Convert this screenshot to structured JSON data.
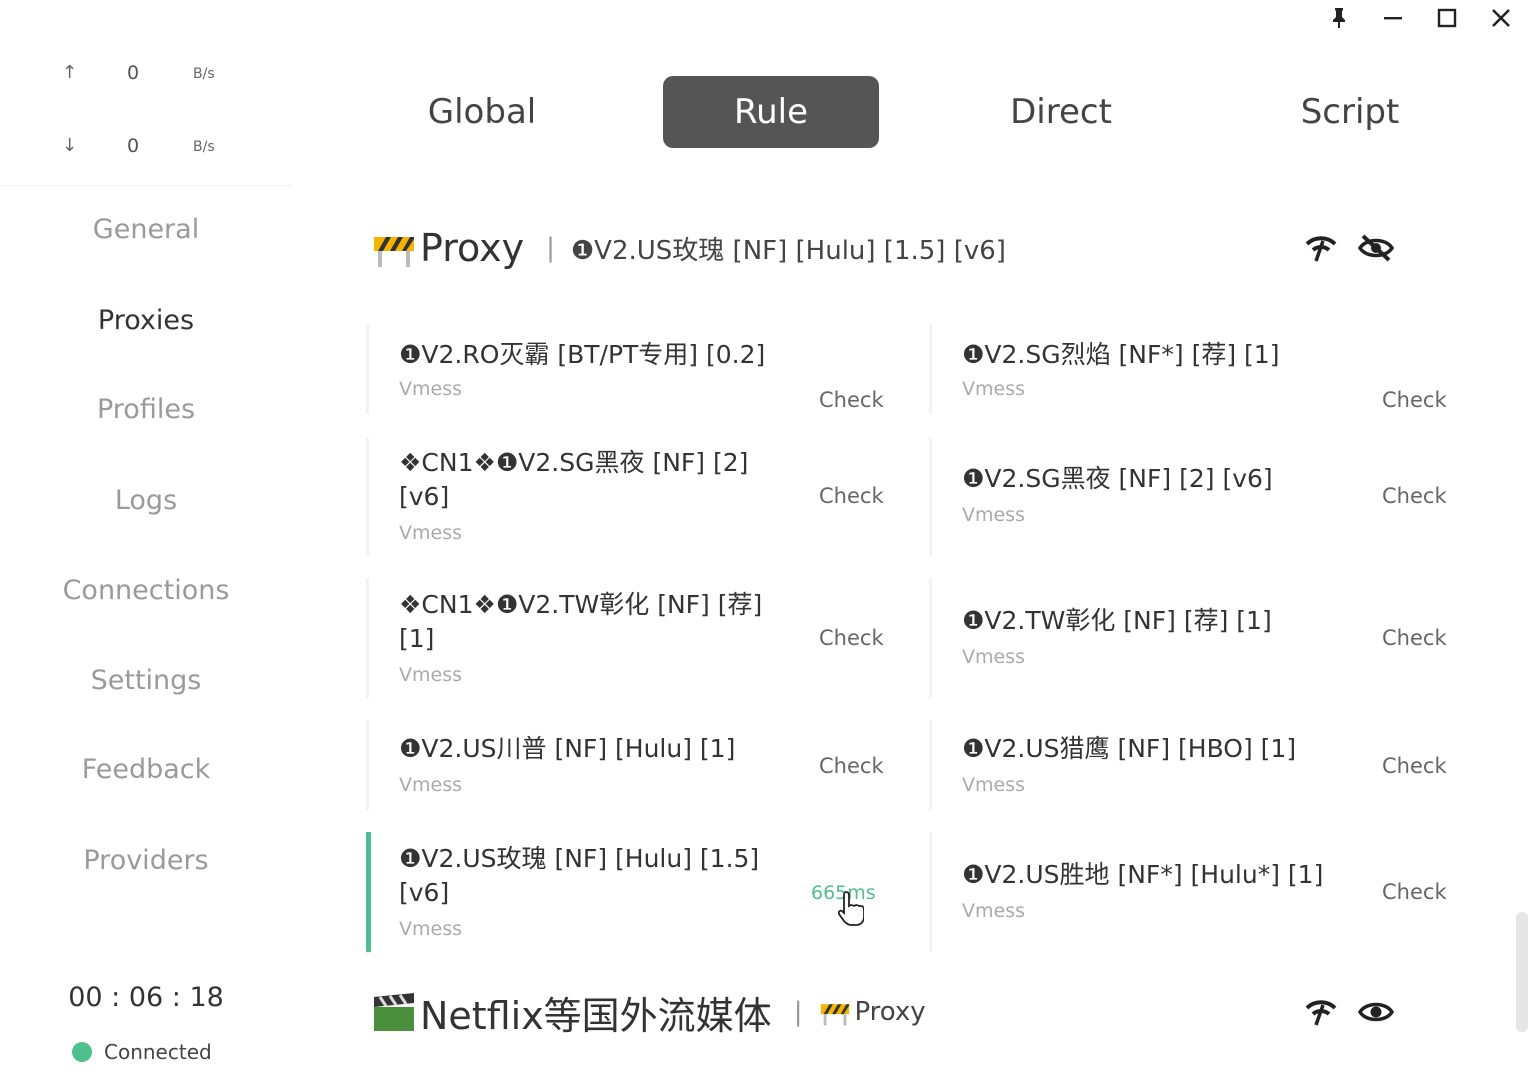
{
  "window": {
    "pin_icon": "pin-icon",
    "minimize_icon": "minimize-icon",
    "maximize_icon": "maximize-icon",
    "close_icon": "close-icon"
  },
  "traffic": {
    "up_arrow": "↑",
    "up_value": "0",
    "up_unit": "B/s",
    "down_arrow": "↓",
    "down_value": "0",
    "down_unit": "B/s"
  },
  "sidebar": {
    "items": [
      {
        "label": "General"
      },
      {
        "label": "Proxies"
      },
      {
        "label": "Profiles"
      },
      {
        "label": "Logs"
      },
      {
        "label": "Connections"
      },
      {
        "label": "Settings"
      },
      {
        "label": "Feedback"
      },
      {
        "label": "Providers"
      }
    ],
    "active": "Proxies",
    "clock": "00 : 06 : 18",
    "status": "Connected",
    "status_color": "#4fc08d"
  },
  "modes": {
    "items": [
      {
        "label": "Global"
      },
      {
        "label": "Rule"
      },
      {
        "label": "Direct"
      },
      {
        "label": "Script"
      }
    ],
    "active": "Rule"
  },
  "groups": [
    {
      "name": "Proxy",
      "separator": "|",
      "selected": "❶V2.US玫瑰 [NF] [Hulu] [1.5] [v6]",
      "icons": [
        "speed-test-icon",
        "eye-off-icon"
      ],
      "proxies": [
        {
          "name": "❶V2.RO灭霸 [BT/PT专用] [0.2]",
          "type": "Vmess",
          "action": "Check"
        },
        {
          "name": "❶V2.SG烈焰 [NF*] [荐] [1]",
          "type": "Vmess",
          "action": "Check"
        },
        {
          "name": "❖CN1❖❶V2.SG黑夜 [NF] [2] [v6]",
          "type": "Vmess",
          "action": "Check"
        },
        {
          "name": "❶V2.SG黑夜 [NF] [2] [v6]",
          "type": "Vmess",
          "action": "Check"
        },
        {
          "name": "❖CN1❖❶V2.TW彰化 [NF] [荐] [1]",
          "type": "Vmess",
          "action": "Check"
        },
        {
          "name": "❶V2.TW彰化 [NF] [荐] [1]",
          "type": "Vmess",
          "action": "Check"
        },
        {
          "name": "❶V2.US川普 [NF] [Hulu] [1]",
          "type": "Vmess",
          "action": "Check"
        },
        {
          "name": "❶V2.US猎鹰 [NF] [HBO] [1]",
          "type": "Vmess",
          "action": "Check"
        },
        {
          "name": "❶V2.US玫瑰 [NF] [Hulu] [1.5] [v6]",
          "type": "Vmess",
          "delay": "665ms",
          "selected": true
        },
        {
          "name": "❶V2.US胜地 [NF*] [Hulu*] [1]",
          "type": "Vmess",
          "action": "Check"
        }
      ]
    },
    {
      "name": "Netflix等国外流媒体",
      "separator": "|",
      "selected": "Proxy",
      "icons": [
        "speed-test-icon",
        "eye-icon"
      ]
    }
  ]
}
